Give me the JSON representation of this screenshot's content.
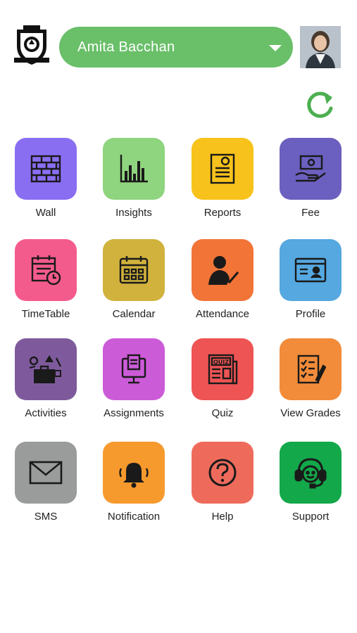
{
  "header": {
    "selected_student": "Amita Bacchan"
  },
  "tiles": [
    {
      "label": "Wall",
      "color": "#8a6ef2",
      "icon": "brick-wall-icon"
    },
    {
      "label": "Insights",
      "color": "#8fd47e",
      "icon": "bar-chart-icon"
    },
    {
      "label": "Reports",
      "color": "#f7c21b",
      "icon": "report-card-icon"
    },
    {
      "label": "Fee",
      "color": "#6b5fbf",
      "icon": "money-hand-icon"
    },
    {
      "label": "TimeTable",
      "color": "#f45b8d",
      "icon": "timetable-calendar-icon"
    },
    {
      "label": "Calendar",
      "color": "#d0b23c",
      "icon": "calendar-icon"
    },
    {
      "label": "Attendance",
      "color": "#f27437",
      "icon": "attendance-person-icon"
    },
    {
      "label": "Profile",
      "color": "#55a8e0",
      "icon": "id-card-icon"
    },
    {
      "label": "Activities",
      "color": "#7e5a9c",
      "icon": "briefcase-activities-icon"
    },
    {
      "label": "Assignments",
      "color": "#cc5bd8",
      "icon": "assignment-monitor-icon"
    },
    {
      "label": "Quiz",
      "color": "#ee5454",
      "icon": "quiz-newspaper-icon"
    },
    {
      "label": "View Grades",
      "color": "#f28c3a",
      "icon": "grades-clipboard-icon"
    },
    {
      "label": "SMS",
      "color": "#9a9b9b",
      "icon": "envelope-icon"
    },
    {
      "label": "Notification",
      "color": "#f79a2e",
      "icon": "bell-icon"
    },
    {
      "label": "Help",
      "color": "#ee6b5c",
      "icon": "help-question-icon"
    },
    {
      "label": "Support",
      "color": "#13a84a",
      "icon": "headset-support-icon"
    }
  ],
  "colors": {
    "selector_green": "#6abf69",
    "refresh_green": "#4caf50"
  }
}
